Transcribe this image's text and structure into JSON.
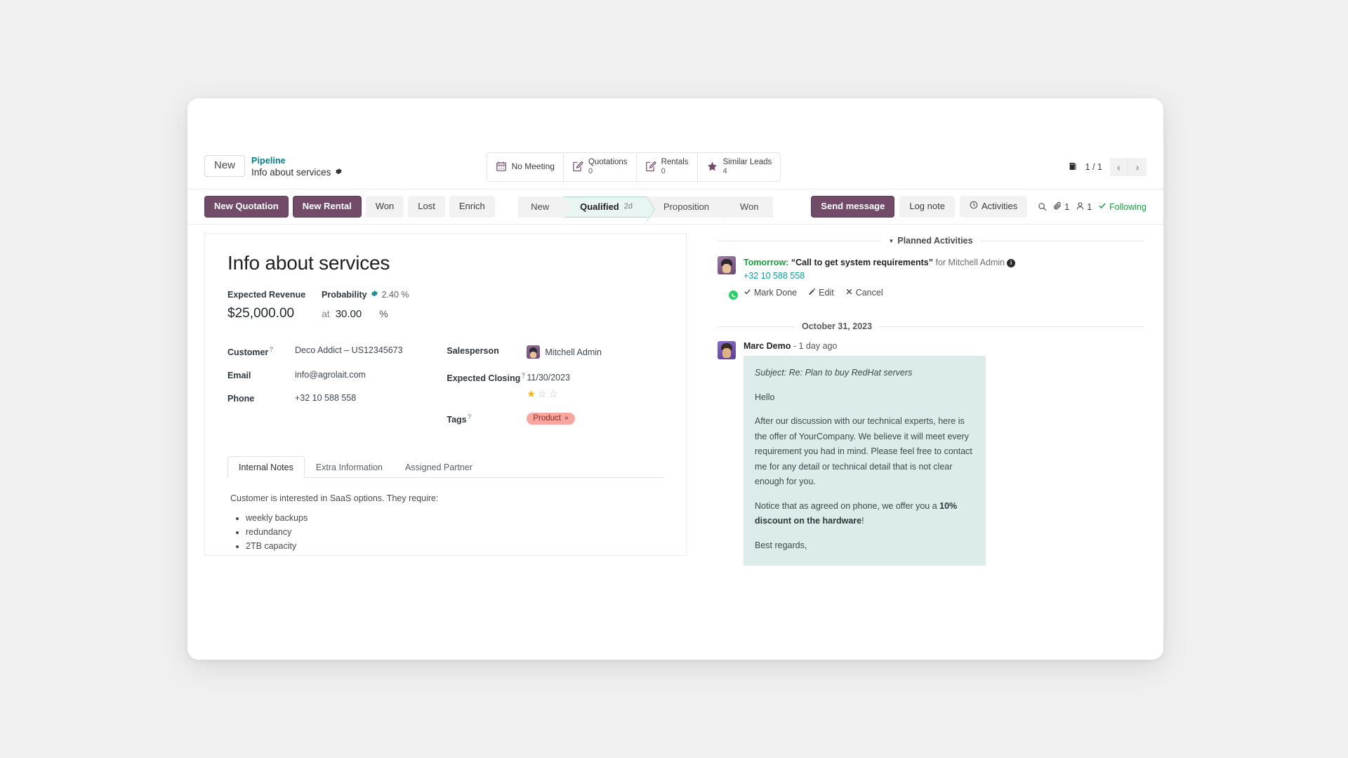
{
  "breadcrumb": {
    "new_button": "New",
    "parent": "Pipeline",
    "current": "Info about services",
    "gear_icon": "gear-icon"
  },
  "stat_buttons": [
    {
      "label": "No Meeting",
      "value": "",
      "icon": "calendar-icon"
    },
    {
      "label": "Quotations",
      "value": "0",
      "icon": "document-edit-icon"
    },
    {
      "label": "Rentals",
      "value": "0",
      "icon": "document-edit-icon"
    },
    {
      "label": "Similar Leads",
      "value": "4",
      "icon": "star-icon"
    }
  ],
  "pager": {
    "archive_icon": "archive-box-icon",
    "count": "1 / 1",
    "prev": "‹",
    "next": "›"
  },
  "actions": {
    "primary": [
      "New Quotation",
      "New Rental"
    ],
    "secondary": [
      "Won",
      "Lost",
      "Enrich"
    ]
  },
  "stages": [
    {
      "label": "New",
      "sub": "",
      "active": false
    },
    {
      "label": "Qualified",
      "sub": "2d",
      "active": true
    },
    {
      "label": "Proposition",
      "sub": "",
      "active": false
    },
    {
      "label": "Won",
      "sub": "",
      "active": false
    }
  ],
  "chatter_tools": {
    "send_message": "Send message",
    "log_note": "Log note",
    "activities": "Activities",
    "activities_icon": "clock-icon",
    "search_icon": "search-icon",
    "attachment_icon": "paperclip-icon",
    "attachment_count": "1",
    "follower_icon": "user-icon",
    "follower_count": "1",
    "following_label": "Following",
    "following_icon": "check-icon"
  },
  "form": {
    "title": "Info about services",
    "expected_revenue_label": "Expected Revenue",
    "expected_revenue_value": "$25,000.00",
    "probability_label": "Probability",
    "probability_gear_icon": "gear-icon",
    "probability_auto": "2.40 %",
    "at_label": "at",
    "probability_value": "30.00",
    "percent_symbol": "%",
    "fields_left": [
      {
        "label": "Customer",
        "help": true,
        "value": "Deco Addict – US12345673"
      },
      {
        "label": "Email",
        "help": false,
        "value": "info@agrolait.com"
      },
      {
        "label": "Phone",
        "help": false,
        "value": "+32 10 588 558"
      }
    ],
    "salesperson_label": "Salesperson",
    "salesperson_value": "Mitchell Admin",
    "salesperson_avatar": "avatar",
    "expected_closing_label": "Expected Closing",
    "expected_closing_value": "11/30/2023",
    "priority_stars": {
      "filled": 1,
      "total": 3
    },
    "tags_label": "Tags",
    "tags": [
      {
        "label": "Product",
        "remove": "×"
      }
    ]
  },
  "notebook": {
    "tabs": [
      {
        "label": "Internal Notes",
        "active": true
      },
      {
        "label": "Extra Information",
        "active": false
      },
      {
        "label": "Assigned Partner",
        "active": false
      }
    ],
    "note_intro": "Customer is interested in SaaS options. They require:",
    "note_items": [
      "weekly backups",
      "redundancy",
      "2TB capacity"
    ]
  },
  "chatter": {
    "planned_activities_label": "Planned Activities",
    "activity": {
      "when": "Tomorrow:",
      "summary": "“Call to get system requirements”",
      "for": "for Mitchell Admin",
      "info_icon": "info-icon",
      "phone": "+32 10 588 558",
      "actions": [
        {
          "label": "Mark Done",
          "icon": "check-icon"
        },
        {
          "label": "Edit",
          "icon": "pencil-icon"
        },
        {
          "label": "Cancel",
          "icon": "close-icon"
        }
      ],
      "avatar_badge": "phone-icon"
    },
    "date_separator": "October 31, 2023",
    "message": {
      "author": "Marc Demo",
      "time": "1 day ago",
      "separator": "-",
      "subject": "Subject: Re: Plan to buy RedHat servers",
      "greeting": "Hello",
      "paragraph1": "After our discussion with our technical experts, here is the offer of YourCompany. We believe it will meet every requirement you had in mind. Please feel free to contact me for any detail or technical detail that is not clear enough for you.",
      "paragraph2_pre": "Notice that as agreed on phone, we offer you a ",
      "paragraph2_bold": "10% discount on the hardware",
      "paragraph2_post": "!",
      "closing": "Best regards,"
    }
  },
  "colors": {
    "primary": "#714b67",
    "accent_teal": "#017e84",
    "stage_active_bg": "#e9f5f2",
    "tag_bg": "#f8a6a0",
    "message_bg": "#dceceb",
    "following_green": "#1a9e3f"
  }
}
